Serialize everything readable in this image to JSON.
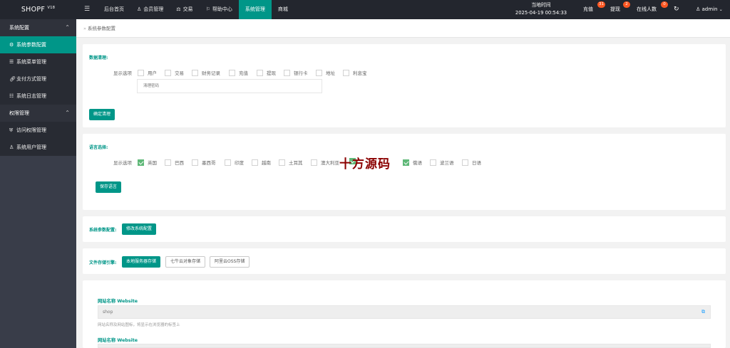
{
  "brand": {
    "name": "SHOPF",
    "version": "V18"
  },
  "topnav": [
    {
      "label": "后台首页",
      "icon": "",
      "active": false
    },
    {
      "label": "会员管理",
      "icon": "user-icon",
      "active": false
    },
    {
      "label": "交易",
      "icon": "scale-icon",
      "active": false
    },
    {
      "label": "帮助中心",
      "icon": "flag-icon",
      "active": false
    },
    {
      "label": "系统管理",
      "icon": "",
      "active": true
    },
    {
      "label": "商城",
      "icon": "",
      "active": false
    }
  ],
  "clock": {
    "label": "当地时间",
    "value": "2025-04-19 00:54:33"
  },
  "header_right": {
    "recharge": {
      "label": "充值",
      "badge": "31"
    },
    "withdraw": {
      "label": "提现",
      "badge": "2"
    },
    "online": {
      "label": "在线人数",
      "badge": "0"
    },
    "user": "admin"
  },
  "sidebar": {
    "group1": "系统配置",
    "group1_items": [
      "系统参数配置",
      "系统菜单管理",
      "支付方式管理",
      "系统日志管理"
    ],
    "group2": "权限管理",
    "group2_items": [
      "访问权限管理",
      "系统用户管理"
    ]
  },
  "breadcrumb": "系统参数配置",
  "data_clean": {
    "title": "数据清理:",
    "display_label": "显示选项",
    "options": [
      "用户",
      "交易",
      "财务记录",
      "充值",
      "提现",
      "银行卡",
      "地址",
      "利息宝"
    ],
    "password_placeholder": "清理密码",
    "button": "确定清理"
  },
  "language": {
    "title": "语言选择:",
    "display_label": "显示选项",
    "options": [
      {
        "label": "英国",
        "checked": true
      },
      {
        "label": "巴西",
        "checked": false
      },
      {
        "label": "墨西哥",
        "checked": false
      },
      {
        "label": "印度",
        "checked": false
      },
      {
        "label": "越南",
        "checked": false
      },
      {
        "label": "土耳其",
        "checked": false
      },
      {
        "label": "澳大利亚",
        "checked": false
      },
      {
        "label": "",
        "checked": true
      },
      {
        "label": "俄语",
        "checked": true
      },
      {
        "label": "波兰语",
        "checked": false
      },
      {
        "label": "日语",
        "checked": false
      }
    ],
    "button": "保存语言"
  },
  "watermark": "十方源码",
  "system_params": {
    "title": "系统参数配置:",
    "button": "修改系统配置"
  },
  "storage": {
    "title": "文件存储引擎:",
    "buttons": [
      "本地服务器存储",
      "七牛云对象存储",
      "阿里云OSS存储"
    ]
  },
  "site_field_1": {
    "title": "网站名称 Website",
    "value": "shop",
    "help": "网站名称及网站图标，将显示在浏览器的标签上"
  },
  "site_field_2": {
    "title": "网站名称 Website"
  }
}
